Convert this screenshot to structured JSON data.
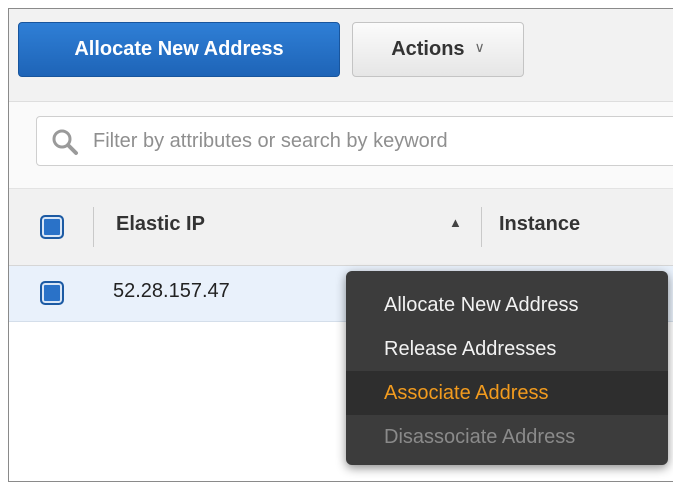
{
  "toolbar": {
    "primary_button": "Allocate New Address",
    "actions_button": "Actions",
    "actions_chevron": "chevron-down-icon"
  },
  "filter": {
    "icon": "search-icon",
    "placeholder": "Filter by attributes or search by keyword"
  },
  "table": {
    "columns": [
      "Elastic IP",
      "Instance"
    ],
    "sort_icon": "sort-ascending-icon",
    "rows": [
      {
        "elastic_ip": "52.28.157.47",
        "selected": true
      }
    ]
  },
  "context_menu": {
    "items": [
      {
        "label": "Allocate New Address",
        "state": "normal"
      },
      {
        "label": "Release Addresses",
        "state": "normal"
      },
      {
        "label": "Associate Address",
        "state": "highlighted"
      },
      {
        "label": "Disassociate Address",
        "state": "disabled"
      }
    ]
  },
  "colors": {
    "primary": "#1e64b7",
    "menu_background": "#3c3c3c",
    "menu_highlight": "#f29b1e",
    "selected_row": "#e9f1fb"
  }
}
